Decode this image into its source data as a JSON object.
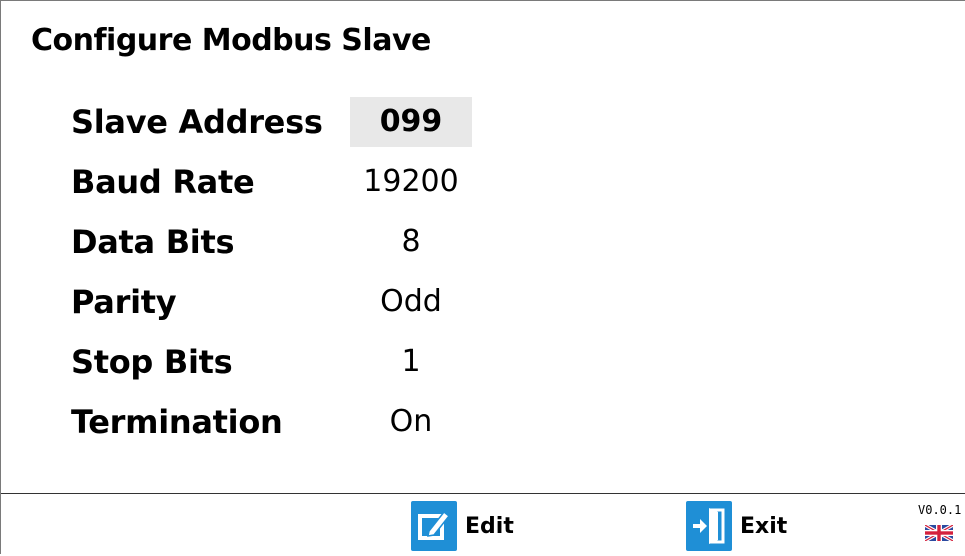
{
  "screen": {
    "title": "Configure Modbus Slave"
  },
  "settings": [
    {
      "label": "Slave Address",
      "value": "099",
      "selected": true
    },
    {
      "label": "Baud Rate",
      "value": "19200",
      "selected": false
    },
    {
      "label": "Data Bits",
      "value": "8",
      "selected": false
    },
    {
      "label": "Parity",
      "value": "Odd",
      "selected": false
    },
    {
      "label": "Stop Bits",
      "value": "1",
      "selected": false
    },
    {
      "label": "Termination",
      "value": "On",
      "selected": false
    }
  ],
  "footer": {
    "edit_label": "Edit",
    "edit_icon": "edit-icon",
    "exit_label": "Exit",
    "exit_icon": "exit-door-icon",
    "version": "V0.0.1",
    "language_icon": "uk-flag-icon"
  },
  "colors": {
    "accent": "#1f8fd6",
    "selected_bg": "#e8e8e8"
  }
}
